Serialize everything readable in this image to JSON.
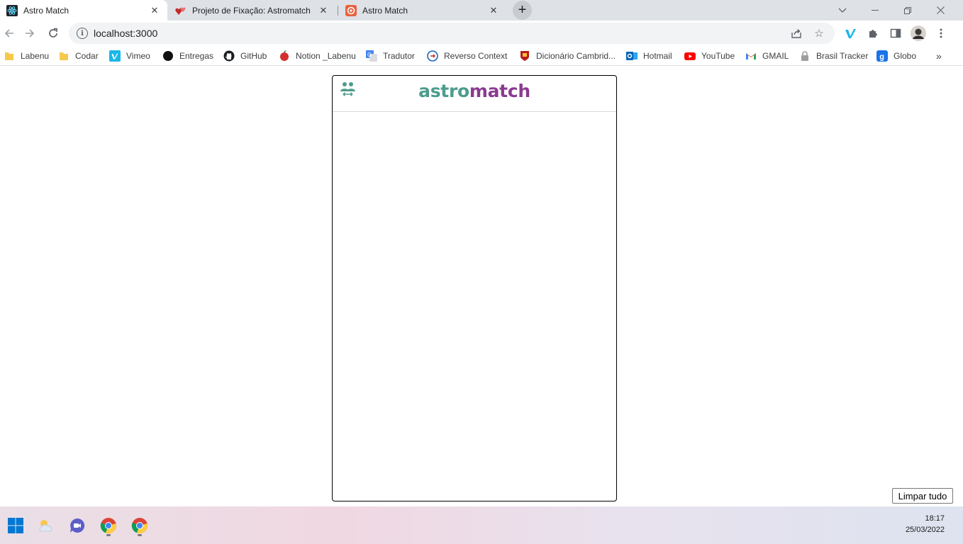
{
  "browser": {
    "tabs": [
      {
        "title": "Astro Match",
        "favicon": "react-icon",
        "active": true
      },
      {
        "title": "Projeto de Fixação: Astromatch",
        "favicon": "hearts-icon",
        "active": false
      },
      {
        "title": "Astro Match",
        "favicon": "astro-icon",
        "active": false
      }
    ],
    "new_tab_symbol": "+",
    "address": "localhost:3000",
    "bookmarks": [
      {
        "label": "Labenu",
        "icon": "folder-icon"
      },
      {
        "label": "Codar",
        "icon": "folder-icon"
      },
      {
        "label": "Vimeo",
        "icon": "vimeo-icon"
      },
      {
        "label": "Entregas",
        "icon": "circle-icon"
      },
      {
        "label": "GitHub",
        "icon": "github-icon"
      },
      {
        "label": "Notion _Labenu",
        "icon": "apple-icon"
      },
      {
        "label": "Tradutor",
        "icon": "translate-icon"
      },
      {
        "label": "Reverso Context",
        "icon": "reverso-icon"
      },
      {
        "label": "Dicionário Cambrid...",
        "icon": "cambridge-icon"
      },
      {
        "label": "Hotmail",
        "icon": "outlook-icon"
      },
      {
        "label": "YouTube",
        "icon": "youtube-icon"
      },
      {
        "label": "GMAIL",
        "icon": "gmail-icon"
      },
      {
        "label": "Brasil Tracker",
        "icon": "lock-icon"
      },
      {
        "label": "Globo",
        "icon": "globo-icon"
      }
    ],
    "bookmarks_overflow": "»"
  },
  "app": {
    "logo_part1": "astro",
    "logo_part2": "match",
    "colors": {
      "teal": "#4d9c8e",
      "purple": "#8a3b8f"
    }
  },
  "page": {
    "clear_button_label": "Limpar tudo"
  },
  "taskbar": {
    "time": "18:17",
    "date": "25/03/2022"
  }
}
